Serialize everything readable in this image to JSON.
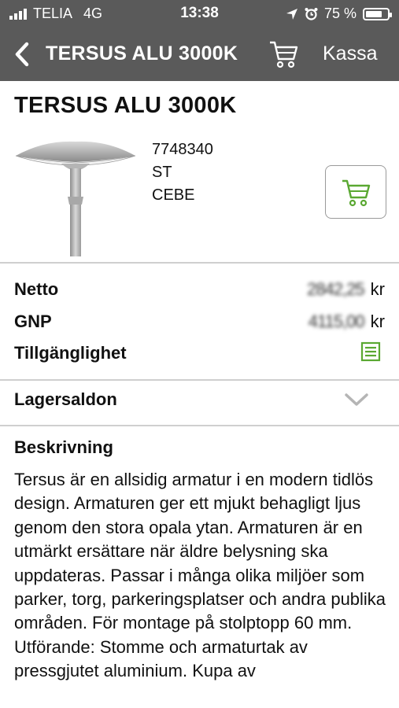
{
  "status_bar": {
    "carrier": "TELIA",
    "network": "4G",
    "time": "13:38",
    "battery": "75 %",
    "battery_level": 0.75
  },
  "nav": {
    "title": "TERSUS ALU 3000K",
    "checkout_label": "Kassa"
  },
  "product": {
    "title": "TERSUS ALU 3000K",
    "article_number": "7748340",
    "unit": "ST",
    "brand": "CEBE"
  },
  "prices": {
    "netto_label": "Netto",
    "netto_value": "2842,25",
    "currency": "kr",
    "gnp_label": "GNP",
    "gnp_value": "4115,00",
    "availability_label": "Tillgänglighet"
  },
  "stock": {
    "label": "Lagersaldon"
  },
  "description": {
    "heading": "Beskrivning",
    "text": "Tersus är en allsidig armatur i en modern tidlös design. Armaturen ger ett mjukt behagligt ljus genom den stora opala ytan. Armaturen är en utmärkt ersättare när äldre belysning ska uppdateras. Passar i många olika miljöer som parker, torg, parkeringsplatser och andra publika områden. För montage på stolptopp 60 mm. Utförande: Stomme och armaturtak av pressgjutet aluminium. Kupa av"
  },
  "colors": {
    "nav_bg": "#5a5a5a",
    "accent_green": "#5aa832"
  }
}
